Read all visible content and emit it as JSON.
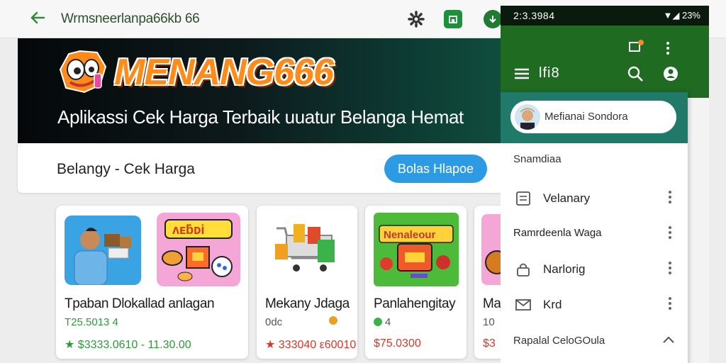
{
  "browser": {
    "url": "Wrmsneerlanpa66kb 66"
  },
  "hero": {
    "brand": "MENANG666",
    "tagline": "Aplikassi Cek Harga Terbaik uuatur Belanga Hemat"
  },
  "section": {
    "title": "Belangy - Cek Harga",
    "cta_label": "Bolas Hlapoe"
  },
  "products": [
    {
      "title": "Tpaban Dlokallad anlagan",
      "sub": "T25.5013 4",
      "price": "★ $3333.0610 - 11.30.00",
      "sub_color": "#2e9a3c",
      "price_color": "#2e9a3c"
    },
    {
      "title": "Mekany Jdaga",
      "sub": "0dc",
      "price": "★ 333040 ε60010",
      "sub_color": "#555555",
      "price_color": "#d23a2a"
    },
    {
      "title": "Panlahengitay",
      "sub": "4",
      "price": "$75.0300",
      "sub_color": "#555555",
      "price_color": "#d23a2a"
    },
    {
      "title": "Ma",
      "sub": "10",
      "price": "$3",
      "sub_color": "#555555",
      "price_color": "#d23a2a"
    }
  ],
  "phone": {
    "status_time": "2:3.3984",
    "status_right": "▼◢ 23%",
    "app_title": "lfi8",
    "profile_name": "Mefianai Sondora",
    "section_1": "Snamdiaa",
    "items": [
      {
        "label": "Velanary"
      },
      {
        "label": "Ramrdeenla Waga"
      },
      {
        "label": "Narlorig"
      },
      {
        "label": "Krd"
      }
    ],
    "section_2": "Rapalal CeloGOula"
  },
  "colors": {
    "accent_green": "#1f6b22",
    "cta_blue": "#2d9be3",
    "brand_orange": "#ff8c1a"
  }
}
